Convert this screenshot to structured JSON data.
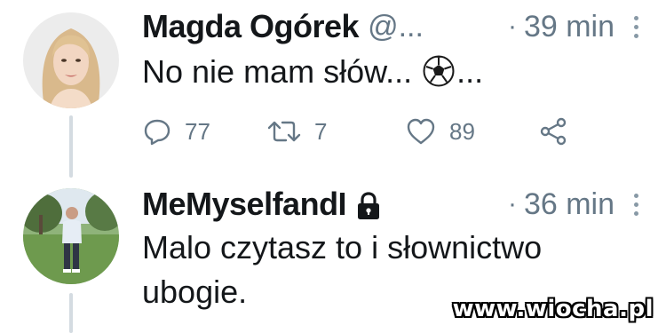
{
  "tweets": [
    {
      "display_name": "Magda Ogórek",
      "handle": "@...",
      "time_separator": "·",
      "time": "39 min",
      "text_before_emoji": "No nie mam słów... ",
      "emoji_icon": "soccer-ball-icon",
      "text_after_emoji": "...",
      "actions": {
        "replies": "77",
        "retweets": "7",
        "likes": "89"
      }
    },
    {
      "display_name": "MeMyselfandI",
      "protected_icon": "lock-icon",
      "time_separator": "·",
      "time": "36 min",
      "text": "Malo czytasz to i słownictwo ubogie."
    }
  ],
  "watermark": "www.wiocha.pl",
  "colors": {
    "text": "#14171a",
    "secondary": "#657786",
    "thread_line": "#d4dbe1",
    "icon": "#657786"
  }
}
